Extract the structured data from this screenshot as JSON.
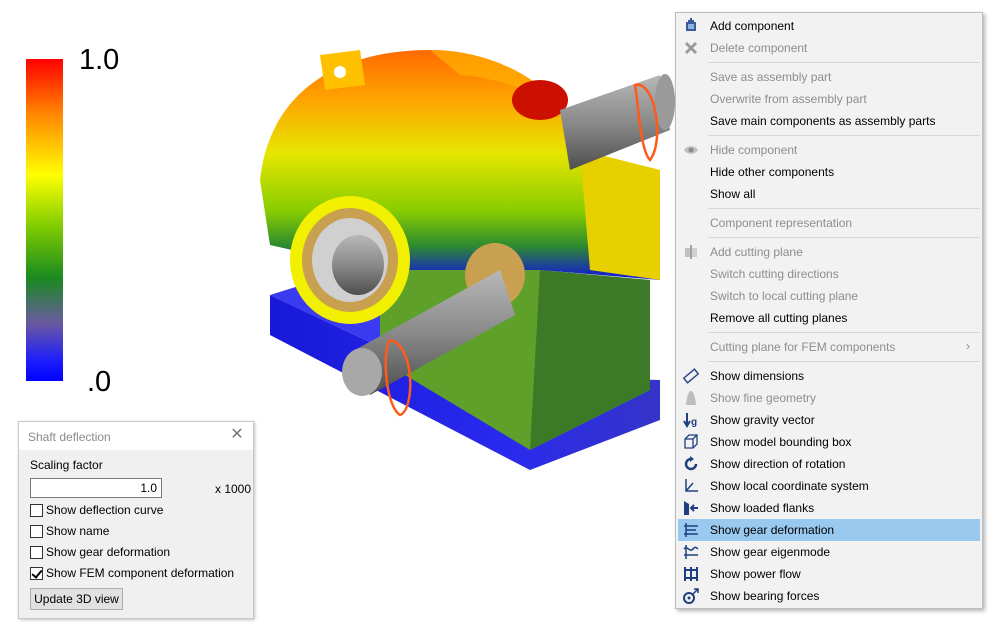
{
  "scale": {
    "max_label": "1.0",
    "min_label": ".0"
  },
  "panel": {
    "title": "Shaft deflection",
    "scaling_label": "Scaling factor",
    "scaling_value": "1.0",
    "scaling_unit": "x 1000",
    "checkboxes": [
      {
        "label": "Show deflection curve",
        "checked": false
      },
      {
        "label": "Show name",
        "checked": false
      },
      {
        "label": "Show gear deformation",
        "checked": false
      },
      {
        "label": "Show FEM component deformation",
        "checked": true
      }
    ],
    "update_button": "Update 3D view"
  },
  "menu": {
    "items": [
      {
        "label": "Add component",
        "icon": "add-component-icon",
        "enabled": true
      },
      {
        "label": "Delete component",
        "icon": "delete-icon",
        "enabled": false
      },
      {
        "label": "Save as assembly part",
        "enabled": false
      },
      {
        "label": "Overwrite from assembly part",
        "enabled": false
      },
      {
        "label": "Save main components as assembly parts",
        "enabled": true
      },
      {
        "label": "Hide component",
        "icon": "eye-icon",
        "enabled": false
      },
      {
        "label": "Hide other components",
        "enabled": true
      },
      {
        "label": "Show all",
        "enabled": true
      },
      {
        "label": "Component representation",
        "enabled": false
      },
      {
        "label": "Add cutting plane",
        "icon": "cutting-plane-icon",
        "enabled": false
      },
      {
        "label": "Switch cutting directions",
        "enabled": false
      },
      {
        "label": "Switch to local cutting plane",
        "enabled": false
      },
      {
        "label": "Remove all cutting planes",
        "enabled": true
      },
      {
        "label": "Cutting plane for FEM components",
        "enabled": false,
        "submenu": true
      },
      {
        "label": "Show dimensions",
        "icon": "ruler-icon",
        "enabled": true
      },
      {
        "label": "Show fine geometry",
        "icon": "fine-geometry-icon",
        "enabled": false
      },
      {
        "label": "Show gravity vector",
        "icon": "gravity-icon",
        "enabled": true
      },
      {
        "label": "Show model bounding box",
        "icon": "bounding-box-icon",
        "enabled": true
      },
      {
        "label": "Show direction of rotation",
        "icon": "rotation-icon",
        "enabled": true
      },
      {
        "label": "Show local coordinate system",
        "icon": "coordinate-system-icon",
        "enabled": true
      },
      {
        "label": "Show loaded flanks",
        "icon": "loaded-flanks-icon",
        "enabled": true
      },
      {
        "label": "Show gear deformation",
        "icon": "gear-deformation-icon",
        "enabled": true,
        "highlighted": true
      },
      {
        "label": "Show gear eigenmode",
        "icon": "eigenmode-icon",
        "enabled": true
      },
      {
        "label": "Show power flow",
        "icon": "power-flow-icon",
        "enabled": true
      },
      {
        "label": "Show bearing forces",
        "icon": "bearing-forces-icon",
        "enabled": true
      }
    ]
  }
}
